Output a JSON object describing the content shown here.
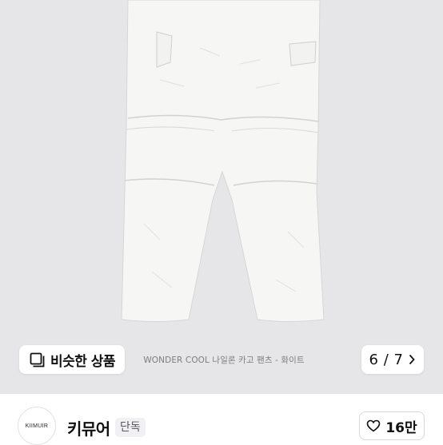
{
  "image": {
    "subject": "white-nylon-cargo-pants-photo"
  },
  "gallery": {
    "similar_label": "비슷한 상품",
    "caption": "WONDER COOL 나일론 카고 팬츠 - 화이트",
    "page": "6 / 7"
  },
  "shop": {
    "logo_text": "KIIMUIR",
    "name": "키뮤어",
    "badge": "단독"
  },
  "like": {
    "count": "16만"
  },
  "colors": {
    "photo_bg": "#e6e6e8",
    "garment": "#f6f6f4",
    "text_dark": "#111111",
    "caption_gray": "#7d7d80"
  }
}
